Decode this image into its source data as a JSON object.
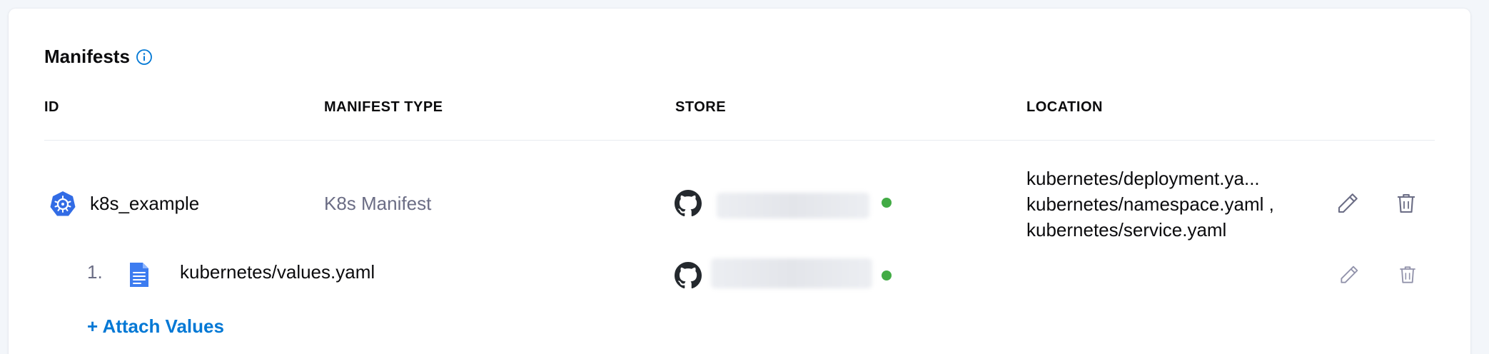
{
  "section": {
    "title": "Manifests",
    "info_icon": "info-circle-icon"
  },
  "table": {
    "headers": [
      "ID",
      "MANIFEST TYPE",
      "STORE",
      "LOCATION"
    ]
  },
  "manifest": {
    "id": "k8s_example",
    "type": "K8s Manifest",
    "store_icon": "github-icon",
    "store_status_color": "#42ab45",
    "locations": [
      "kubernetes/deployment.ya...",
      "kubernetes/namespace.yaml ,",
      "kubernetes/service.yaml"
    ]
  },
  "values_files": [
    {
      "index": "1.",
      "name": "kubernetes/values.yaml",
      "store_icon": "github-icon",
      "store_status_color": "#42ab45"
    }
  ],
  "actions": {
    "attach_values": "+ Attach Values"
  },
  "colors": {
    "accent": "#0278d5",
    "k8s_blue": "#326ce5",
    "status_green": "#42ab45"
  }
}
